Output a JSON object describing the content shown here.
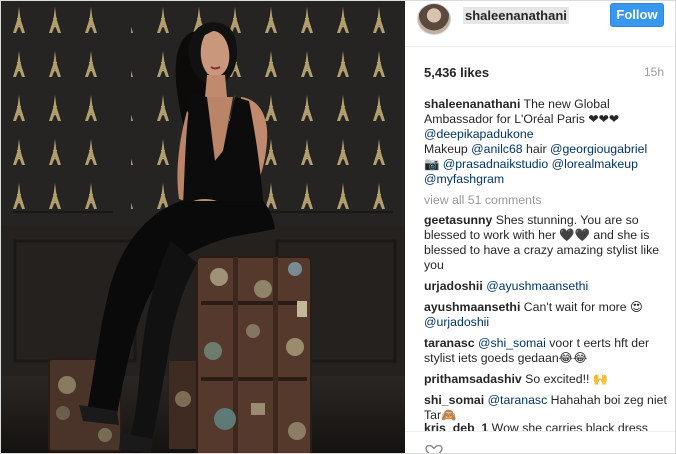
{
  "post": {
    "username": "shaleenanathani",
    "follow_label": "Follow",
    "likes": "5,436 likes",
    "timestamp": "15h"
  },
  "caption": {
    "username": "shaleenanathani",
    "text": " The new Global Ambassador for L'Oréal Paris ❤❤❤",
    "tag1": "@deepikapadukone",
    "makeup_label": "Makeup ",
    "tag2": "@anilc68",
    "hair_label": " hair ",
    "tag3": "@georgiougabriel",
    "camera": "📷 ",
    "tag4": "@prasadnaikstudio",
    "tag5": "@lorealmakeup",
    "tag6": "@myfashgram"
  },
  "view_all": "view all 51 comments",
  "comments": [
    {
      "user": "geetasunny",
      "text": " Shes stunning. You are so blessed to work with her 🖤🖤 and she is blessed to have a crazy amazing stylist like you"
    },
    {
      "user": "urjadoshii",
      "mention": "@ayushmaansethi",
      "text": ""
    },
    {
      "user": "ayushmaansethi",
      "text": " Can't wait for more 😍 ",
      "mention": "@urjadoshii"
    },
    {
      "user": "taranasc",
      "mention": "@shi_somai",
      "text": " voor t eerts hft der stylist iets goeds gedaan😂😂"
    },
    {
      "user": "prithamsadashiv",
      "text": " So excited!! 🙌"
    },
    {
      "user": "shi_somai",
      "mention": "@taranasc",
      "text": " Hahahah boi zeg niet Tar🙈"
    },
    {
      "user": "kris_deb_1",
      "text": " Wow she carries black dress"
    }
  ]
}
